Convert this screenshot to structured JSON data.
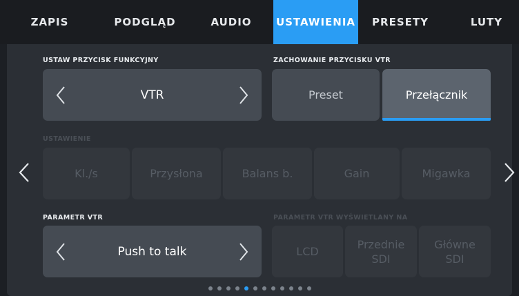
{
  "tabs": [
    {
      "label": "ZAPIS",
      "active": false
    },
    {
      "label": "PODGLĄD",
      "active": false
    },
    {
      "label": "AUDIO",
      "active": false
    },
    {
      "label": "USTAWIENIA",
      "active": true
    },
    {
      "label": "PRESETY",
      "active": false
    },
    {
      "label": "LUTY",
      "active": false
    }
  ],
  "function_button": {
    "label": "USTAW PRZYCISK FUNKCYJNY",
    "value": "VTR"
  },
  "vtr_behavior": {
    "label": "ZACHOWANIE PRZYCISKU VTR",
    "options": [
      "Preset",
      "Przełącznik"
    ],
    "selected": "Przełącznik"
  },
  "setting": {
    "label": "USTAWIENIE",
    "options": [
      "Kl./s",
      "Przysłona",
      "Balans b.",
      "Gain",
      "Migawka"
    ],
    "disabled": true
  },
  "vtr_parameter": {
    "label": "PARAMETR VTR",
    "value": "Push to talk"
  },
  "vtr_display": {
    "label": "PARAMETR VTR WYŚWIETLANY NA",
    "options": [
      "LCD",
      "Przednie\nSDI",
      "Główne\nSDI"
    ],
    "disabled": true
  },
  "pagination": {
    "count": 12,
    "current": 5
  },
  "colors": {
    "accent": "#2a9df4",
    "panel": "#2b2f35",
    "control": "#454b53",
    "control_disabled": "#33373d"
  }
}
